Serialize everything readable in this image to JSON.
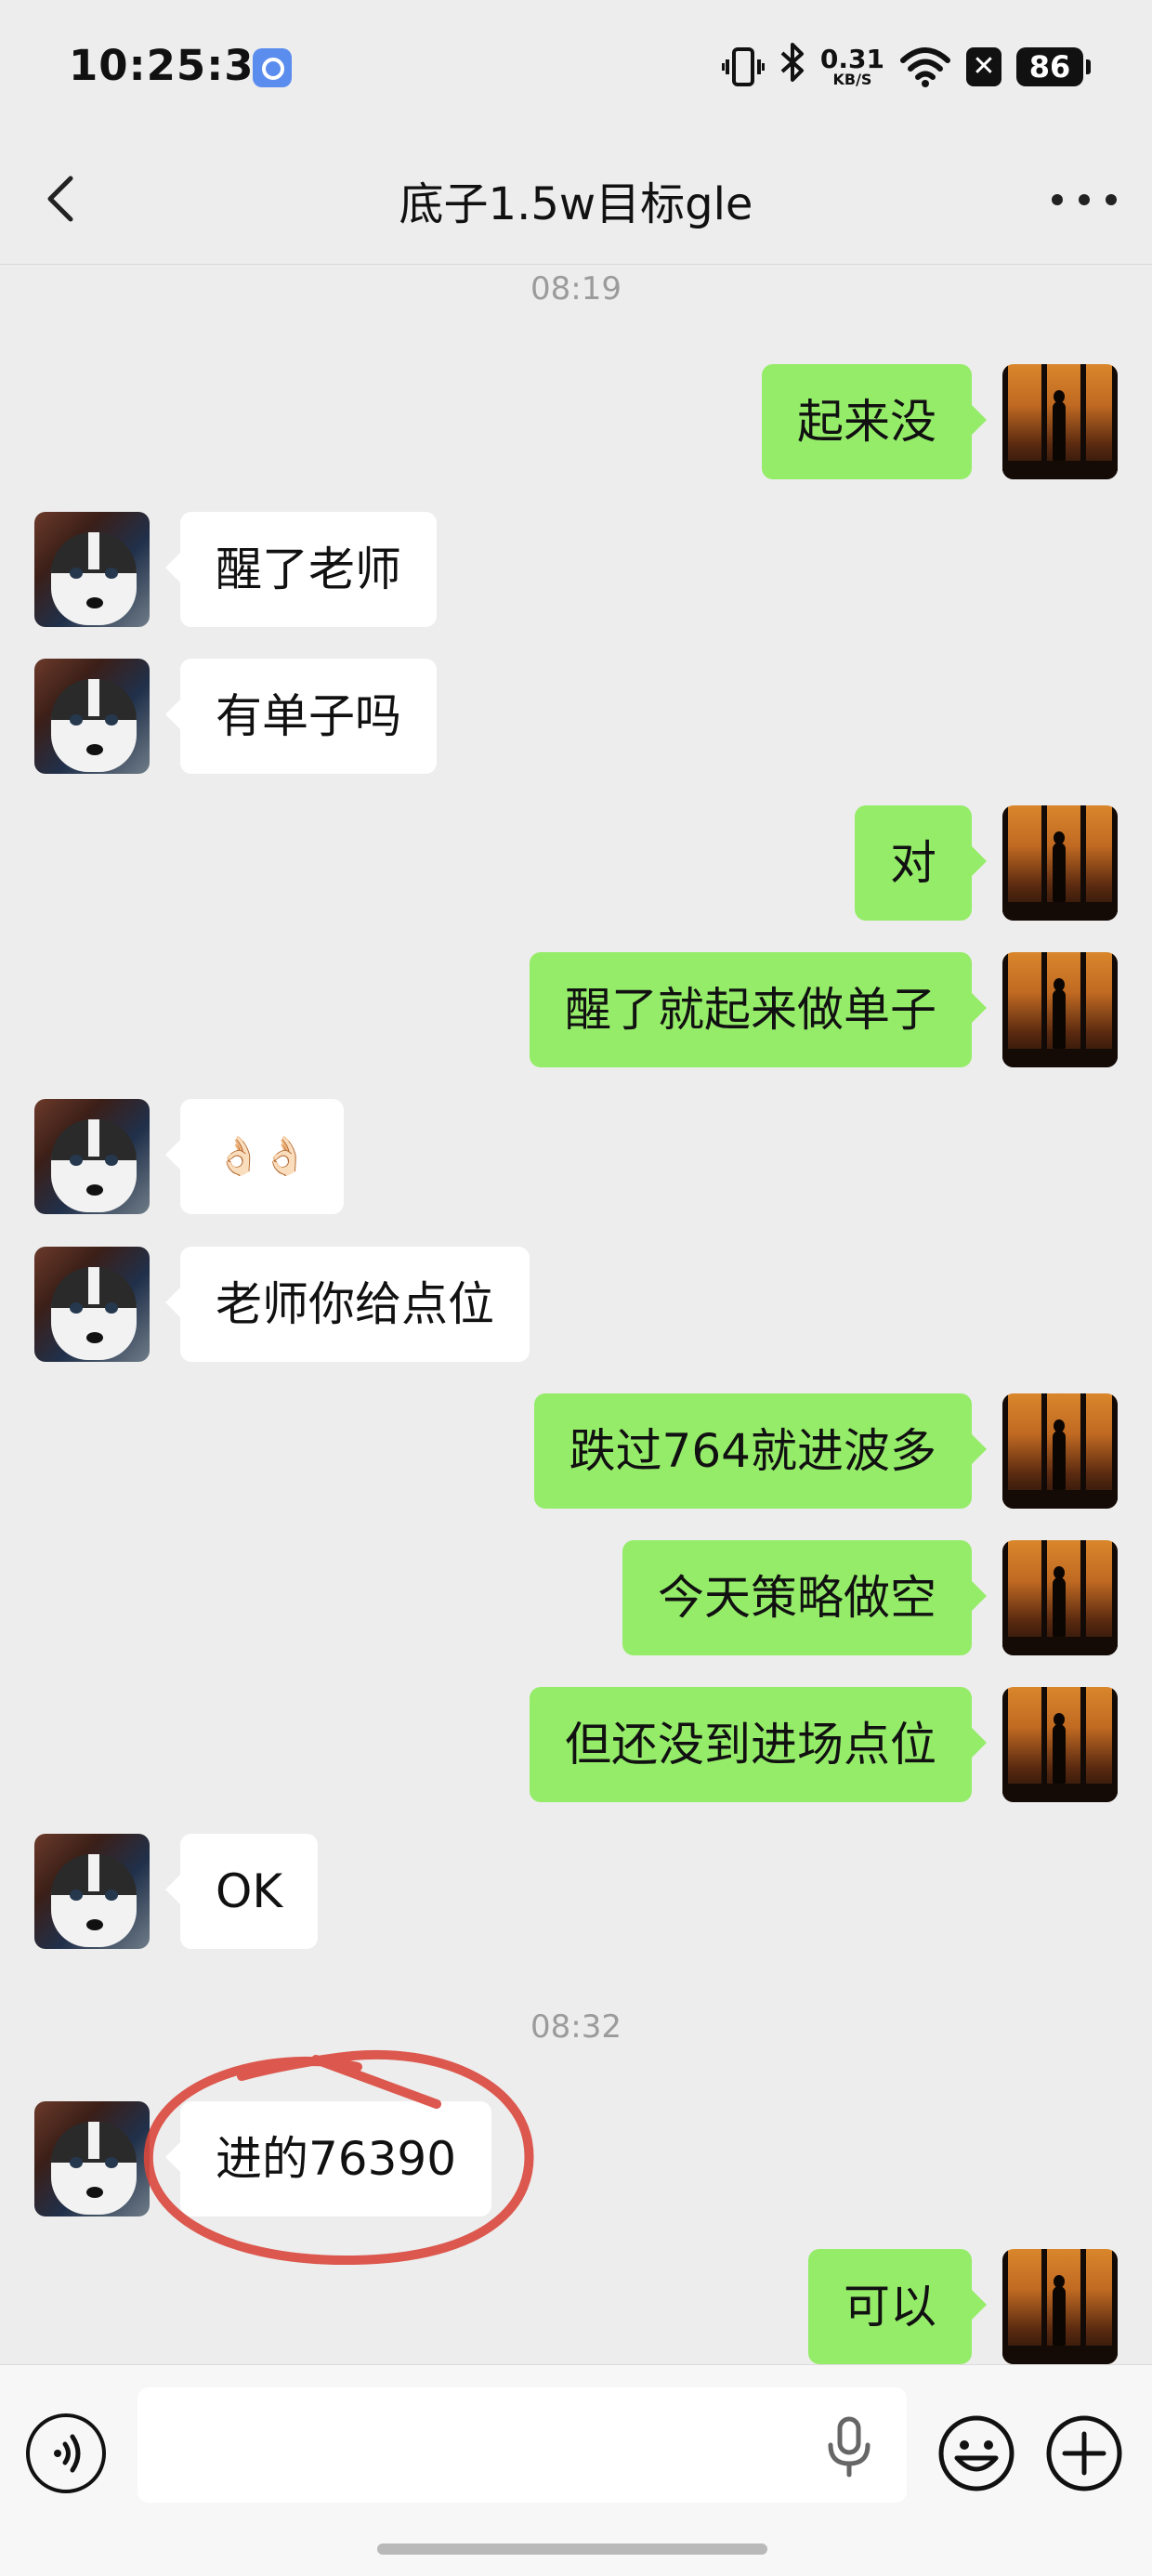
{
  "status_bar": {
    "time": "10:25:31",
    "net_speed_value": "0.31",
    "net_speed_unit": "KB/S",
    "battery": "86",
    "icons": [
      "app-notification-icon",
      "vibrate-icon",
      "bluetooth-icon",
      "wifi-icon",
      "sim-off-icon",
      "battery-icon"
    ]
  },
  "header": {
    "title": "底子1.5w目标gle",
    "back_icon": "back-chevron-icon",
    "more_icon": "more-dots-icon"
  },
  "chat": {
    "timestamps": [
      "08:19",
      "08:32"
    ],
    "messages": [
      {
        "side": "out",
        "text": "起来没"
      },
      {
        "side": "in",
        "text": "醒了老师"
      },
      {
        "side": "in",
        "text": "有单子吗"
      },
      {
        "side": "out",
        "text": "对"
      },
      {
        "side": "out",
        "text": "醒了就起来做单子"
      },
      {
        "side": "in",
        "text": "👌🏻👌🏻"
      },
      {
        "side": "in",
        "text": "老师你给点位"
      },
      {
        "side": "out",
        "text": "跌过764就进波多"
      },
      {
        "side": "out",
        "text": "今天策略做空"
      },
      {
        "side": "out",
        "text": "但还没到进场点位"
      },
      {
        "side": "in",
        "text": "OK"
      },
      {
        "side": "in",
        "text": "进的76390"
      },
      {
        "side": "out",
        "text": "可以"
      }
    ],
    "highlight_color": "#d9473c",
    "bubble_colors": {
      "out": "#95ec69",
      "in": "#ffffff"
    }
  },
  "input_bar": {
    "value": "",
    "icons": [
      "voice-mode-icon",
      "microphone-icon",
      "emoji-icon",
      "plus-icon"
    ]
  }
}
